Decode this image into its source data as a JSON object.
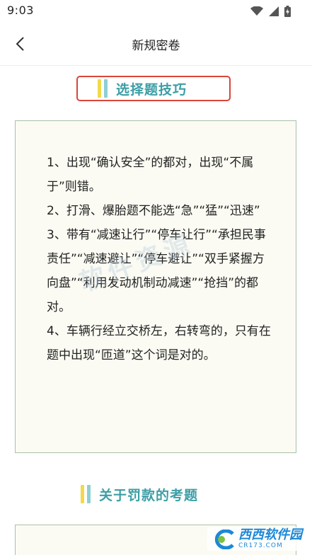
{
  "status_bar": {
    "time": "9:03",
    "icons": [
      "wifi-icon",
      "signal-icon",
      "battery-charging-icon"
    ]
  },
  "nav": {
    "back_icon": "chevron-left-icon",
    "title": "新规密卷"
  },
  "sections": [
    {
      "heading": "选择题技巧",
      "paragraphs": [
        "1、出现“确认安全”的都对，出现“不属于”则错。",
        "2、打滑、爆胎题不能选“急”“猛”“迅速”",
        "3、带有“减速让行”“停车让行”“承担民事责任”“减速避让”“停车避让”“双手紧握方向盘”“利用发动机制动减速”“抢挡”的都对。",
        "4、车辆行经立交桥左，右转弯的，只有在题中出现“匝道”这个词是对的。"
      ]
    },
    {
      "heading": "关于罚款的考题"
    }
  ],
  "watermark": {
    "text": "软件资源"
  },
  "site_logo": {
    "name": "西西软件园",
    "url": "CR173.COM"
  },
  "colors": {
    "heading_text": "#3d9ea5",
    "bar_yellow": "#f2d94a",
    "bar_teal": "#8ecfd4",
    "highlight_border": "#d9453a",
    "card_background": "#fbfbf3",
    "card_border": "#a9c1a9",
    "logo_blue": "#1e88d6"
  }
}
